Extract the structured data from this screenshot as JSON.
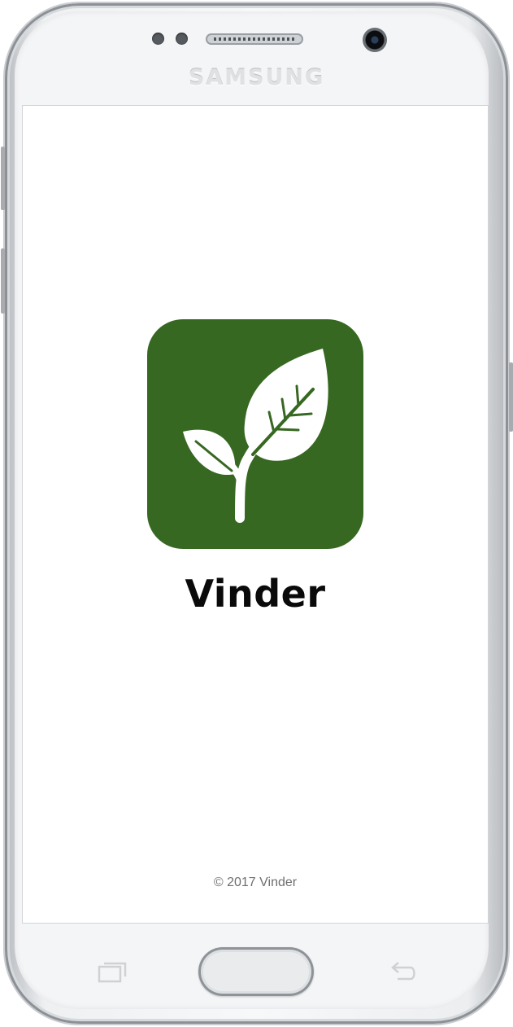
{
  "device": {
    "brand": "SAMSUNG"
  },
  "splash": {
    "app_name": "Vinder",
    "logo_icon": "sprout-leaves-icon",
    "logo_background": "#376822",
    "footer": "© 2017 Vinder"
  },
  "nav_bar": {
    "recent_icon": "recent-apps-icon",
    "home_icon": "home-button",
    "back_icon": "back-arrow-icon"
  }
}
